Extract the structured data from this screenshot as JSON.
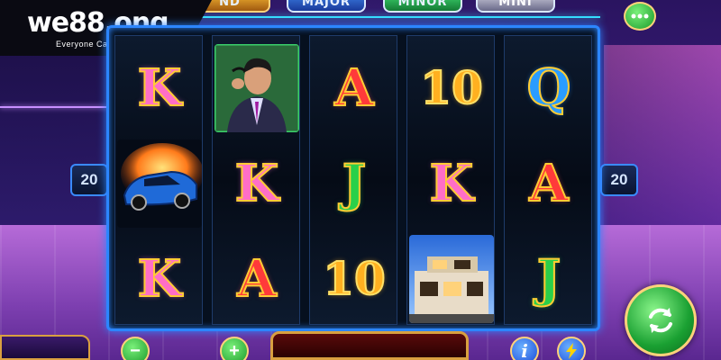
{
  "logo": {
    "brand": "we88.ong",
    "tagline": "Everyone Can Win"
  },
  "jackpots": {
    "grand_partial": "ND",
    "major": "MAJOR",
    "minor": "MINOR",
    "mini": "MINI"
  },
  "lines": {
    "left": "20",
    "right": "20"
  },
  "reels": [
    [
      "K",
      "car",
      "K"
    ],
    [
      "businessman",
      "K",
      "A"
    ],
    [
      "A",
      "J",
      "10"
    ],
    [
      "10",
      "K",
      "building"
    ],
    [
      "Q",
      "A",
      "J"
    ]
  ],
  "controls": {
    "minus_label": "−",
    "plus_label": "+",
    "info_label": "i",
    "menu_icon": "dots-icon",
    "spin_icon": "refresh-icon",
    "lightning_icon": "lightning-icon"
  },
  "colors": {
    "frame": "#2c86ff",
    "button_green": "#1aa032",
    "gold": "#ffd27a"
  }
}
